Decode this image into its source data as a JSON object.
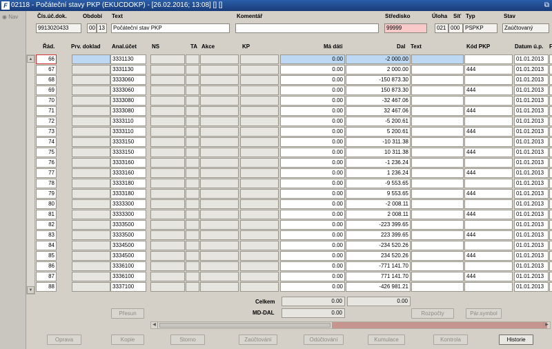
{
  "window": {
    "title": "02118 - Počáteční stavy PKP (EKUCDOKP) - [26.02.2016; 13:08] [] []",
    "logo": "F",
    "restore_glyph": "⧉"
  },
  "sidebar": {
    "nav_label": "Nav"
  },
  "header": {
    "labels": {
      "doc": "Čís.úč.dok.",
      "period": "Období",
      "text": "Text",
      "comment": "Komentář",
      "center": "Středisko",
      "task": "Úloha",
      "net": "Síť",
      "type": "Typ",
      "state": "Stav"
    },
    "values": {
      "doc": "9913020433",
      "period_a": "00",
      "period_b": "13",
      "text": "Počáteční stav PKP",
      "comment": "",
      "center": "99999",
      "task": "021",
      "net": "000",
      "type": "PSPKP",
      "state": "Zaúčtovaný"
    }
  },
  "columns": {
    "rad": "Řád.",
    "prv": "Prv. doklad",
    "anal": "Anal.účet",
    "ns": "NS",
    "ta": "TA",
    "akce": "Akce",
    "kp": "KP",
    "md": "Má dáti",
    "dal": "Dal",
    "text": "Text",
    "kod": "Kód PKP",
    "datum": "Datum ú.p.",
    "extra": "F"
  },
  "rows": [
    {
      "rad": "66",
      "anal": "3331130",
      "md": "0.00",
      "dal": "-2 000.00",
      "kod": "",
      "datum": "01.01.2013"
    },
    {
      "rad": "67",
      "anal": "3331130",
      "md": "0.00",
      "dal": "2 000.00",
      "kod": "444",
      "datum": "01.01.2013"
    },
    {
      "rad": "68",
      "anal": "3333060",
      "md": "0.00",
      "dal": "-150 873.30",
      "kod": "",
      "datum": "01.01.2013"
    },
    {
      "rad": "69",
      "anal": "3333060",
      "md": "0.00",
      "dal": "150 873.30",
      "kod": "444",
      "datum": "01.01.2013"
    },
    {
      "rad": "70",
      "anal": "3333080",
      "md": "0.00",
      "dal": "-32 467.06",
      "kod": "",
      "datum": "01.01.2013"
    },
    {
      "rad": "71",
      "anal": "3333080",
      "md": "0.00",
      "dal": "32 467.06",
      "kod": "444",
      "datum": "01.01.2013"
    },
    {
      "rad": "72",
      "anal": "3333110",
      "md": "0.00",
      "dal": "-5 200.61",
      "kod": "",
      "datum": "01.01.2013"
    },
    {
      "rad": "73",
      "anal": "3333110",
      "md": "0.00",
      "dal": "5 200.61",
      "kod": "444",
      "datum": "01.01.2013"
    },
    {
      "rad": "74",
      "anal": "3333150",
      "md": "0.00",
      "dal": "-10 311.38",
      "kod": "",
      "datum": "01.01.2013"
    },
    {
      "rad": "75",
      "anal": "3333150",
      "md": "0.00",
      "dal": "10 311.38",
      "kod": "444",
      "datum": "01.01.2013"
    },
    {
      "rad": "76",
      "anal": "3333160",
      "md": "0.00",
      "dal": "-1 236.24",
      "kod": "",
      "datum": "01.01.2013"
    },
    {
      "rad": "77",
      "anal": "3333160",
      "md": "0.00",
      "dal": "1 236.24",
      "kod": "444",
      "datum": "01.01.2013"
    },
    {
      "rad": "78",
      "anal": "3333180",
      "md": "0.00",
      "dal": "-9 553.65",
      "kod": "",
      "datum": "01.01.2013"
    },
    {
      "rad": "79",
      "anal": "3333180",
      "md": "0.00",
      "dal": "9 553.65",
      "kod": "444",
      "datum": "01.01.2013"
    },
    {
      "rad": "80",
      "anal": "3333300",
      "md": "0.00",
      "dal": "-2 008.11",
      "kod": "",
      "datum": "01.01.2013"
    },
    {
      "rad": "81",
      "anal": "3333300",
      "md": "0.00",
      "dal": "2 008.11",
      "kod": "444",
      "datum": "01.01.2013"
    },
    {
      "rad": "82",
      "anal": "3333500",
      "md": "0.00",
      "dal": "-223 399.65",
      "kod": "",
      "datum": "01.01.2013"
    },
    {
      "rad": "83",
      "anal": "3333500",
      "md": "0.00",
      "dal": "223 399.65",
      "kod": "444",
      "datum": "01.01.2013"
    },
    {
      "rad": "84",
      "anal": "3334500",
      "md": "0.00",
      "dal": "-234 520.26",
      "kod": "",
      "datum": "01.01.2013"
    },
    {
      "rad": "85",
      "anal": "3334500",
      "md": "0.00",
      "dal": "234 520.26",
      "kod": "444",
      "datum": "01.01.2013"
    },
    {
      "rad": "86",
      "anal": "3336100",
      "md": "0.00",
      "dal": "-771 141.70",
      "kod": "",
      "datum": "01.01.2013"
    },
    {
      "rad": "87",
      "anal": "3336100",
      "md": "0.00",
      "dal": "771 141.70",
      "kod": "444",
      "datum": "01.01.2013"
    },
    {
      "rad": "88",
      "anal": "3337100",
      "md": "0.00",
      "dal": "-426 981.21",
      "kod": "",
      "datum": "01.01.2013"
    }
  ],
  "totals": {
    "celkem_label": "Celkem",
    "celkem_md": "0.00",
    "celkem_dal": "0.00",
    "mddal_label": "MD-DAL",
    "mddal_value": "0.00"
  },
  "buttons": {
    "presun": "Přesun",
    "rozpocty": "Rozpočty",
    "par_symbol": "Pár.symbol",
    "oprava": "Oprava",
    "kopie": "Kopie",
    "storno": "Storno",
    "zauctovani": "Zaúčtování",
    "oductovani": "Odúčtování",
    "kumulace": "Kumulace",
    "kontrola": "Kontrola",
    "historie": "Historie"
  }
}
